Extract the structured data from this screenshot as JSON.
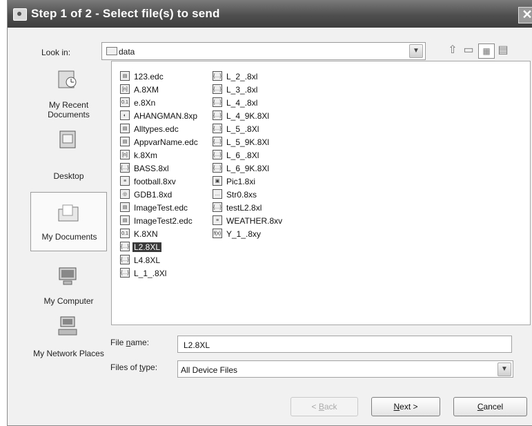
{
  "window": {
    "title": "Step 1 of 2 - Select file(s) to send",
    "close_glyph": "✕"
  },
  "look_in": {
    "label": "Look in:",
    "value": "data"
  },
  "toolbar": {
    "up_icon": "up-folder-icon",
    "new_folder_icon": "new-folder-icon",
    "list_view_icon": "list-view-icon",
    "details_view_icon": "details-view-icon"
  },
  "places": [
    {
      "label": "My Recent Documents",
      "icon": "recent-documents-icon"
    },
    {
      "label": "Desktop",
      "icon": "desktop-icon"
    },
    {
      "label": "My Documents",
      "icon": "my-documents-icon"
    },
    {
      "label": "My Computer",
      "icon": "my-computer-icon"
    },
    {
      "label": "My Network Places",
      "icon": "network-places-icon"
    }
  ],
  "files_col1": [
    {
      "name": "123.edc",
      "glyph": "▤"
    },
    {
      "name": "A.8XM",
      "glyph": "[n]"
    },
    {
      "name": "e.8Xn",
      "glyph": "0.1"
    },
    {
      "name": "AHANGMAN.8xp",
      "glyph": "◐"
    },
    {
      "name": "Alltypes.edc",
      "glyph": "▤"
    },
    {
      "name": "AppvarName.edc",
      "glyph": "▤"
    },
    {
      "name": "k.8Xm",
      "glyph": "[n]"
    },
    {
      "name": "BASS.8xl",
      "glyph": "{…}"
    },
    {
      "name": "football.8xv",
      "glyph": "≡"
    },
    {
      "name": "GDB1.8xd",
      "glyph": "◎"
    },
    {
      "name": "ImageTest.edc",
      "glyph": "▤"
    },
    {
      "name": "ImageTest2.edc",
      "glyph": "▤"
    },
    {
      "name": "K.8XN",
      "glyph": "0.1"
    },
    {
      "name": "L2.8XL",
      "glyph": "{…}"
    },
    {
      "name": "L4.8XL",
      "glyph": "{…}"
    },
    {
      "name": "L_1_.8Xl",
      "glyph": "{…}"
    }
  ],
  "files_col2": [
    {
      "name": "L_2_.8xl",
      "glyph": "{…}"
    },
    {
      "name": "L_3_.8xl",
      "glyph": "{…}"
    },
    {
      "name": "L_4_.8xl",
      "glyph": "{…}"
    },
    {
      "name": "L_4_9K.8Xl",
      "glyph": "{…}"
    },
    {
      "name": "L_5_.8Xl",
      "glyph": "{…}"
    },
    {
      "name": "L_5_9K.8Xl",
      "glyph": "{…}"
    },
    {
      "name": "L_6_.8Xl",
      "glyph": "{…}"
    },
    {
      "name": "L_6_9K.8Xl",
      "glyph": "{…}"
    },
    {
      "name": "Pic1.8xi",
      "glyph": "▣"
    },
    {
      "name": "Str0.8xs",
      "glyph": "…"
    },
    {
      "name": "testL2.8xl",
      "glyph": "{…}"
    },
    {
      "name": "WEATHER.8xv",
      "glyph": "≡"
    },
    {
      "name": "Y_1_.8xy",
      "glyph": "f(x)"
    }
  ],
  "selected_file": "L2.8XL",
  "file_name": {
    "label_pre": "File ",
    "label_u": "n",
    "label_post": "ame:",
    "value": "L2.8XL"
  },
  "file_type": {
    "label_pre": "Files of ",
    "label_u": "t",
    "label_post": "ype:",
    "value": "All Device Files"
  },
  "buttons": {
    "back": {
      "pre": "< ",
      "u": "B",
      "post": "ack"
    },
    "next": {
      "u": "N",
      "post": "ext >"
    },
    "cancel": {
      "u": "C",
      "post": "ancel"
    }
  },
  "colors": {
    "titlebar": "#4f4f4f",
    "selection": "#3a3a3a"
  }
}
